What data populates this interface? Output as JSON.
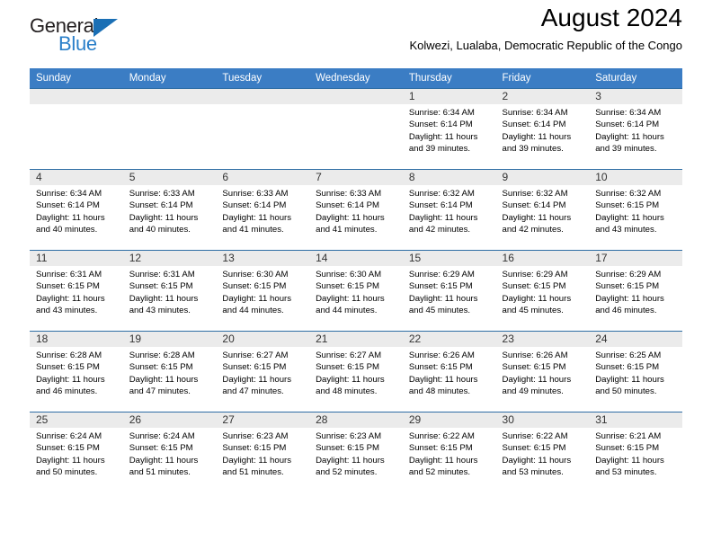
{
  "brand": {
    "name_top": "General",
    "name_bottom": "Blue",
    "triangle_icon": "triangle-icon",
    "accent_color": "#2a7fc9"
  },
  "header": {
    "title": "August 2024",
    "subtitle": "Kolwezi, Lualaba, Democratic Republic of the Congo"
  },
  "calendar": {
    "header_bg": "#3b7dc4",
    "daynum_bg": "#ebebeb",
    "weekdays": [
      "Sunday",
      "Monday",
      "Tuesday",
      "Wednesday",
      "Thursday",
      "Friday",
      "Saturday"
    ],
    "weeks": [
      [
        {
          "day": "",
          "sunrise": "",
          "sunset": "",
          "daylight_line1": "",
          "daylight_line2": ""
        },
        {
          "day": "",
          "sunrise": "",
          "sunset": "",
          "daylight_line1": "",
          "daylight_line2": ""
        },
        {
          "day": "",
          "sunrise": "",
          "sunset": "",
          "daylight_line1": "",
          "daylight_line2": ""
        },
        {
          "day": "",
          "sunrise": "",
          "sunset": "",
          "daylight_line1": "",
          "daylight_line2": ""
        },
        {
          "day": "1",
          "sunrise": "Sunrise: 6:34 AM",
          "sunset": "Sunset: 6:14 PM",
          "daylight_line1": "Daylight: 11 hours",
          "daylight_line2": "and 39 minutes."
        },
        {
          "day": "2",
          "sunrise": "Sunrise: 6:34 AM",
          "sunset": "Sunset: 6:14 PM",
          "daylight_line1": "Daylight: 11 hours",
          "daylight_line2": "and 39 minutes."
        },
        {
          "day": "3",
          "sunrise": "Sunrise: 6:34 AM",
          "sunset": "Sunset: 6:14 PM",
          "daylight_line1": "Daylight: 11 hours",
          "daylight_line2": "and 39 minutes."
        }
      ],
      [
        {
          "day": "4",
          "sunrise": "Sunrise: 6:34 AM",
          "sunset": "Sunset: 6:14 PM",
          "daylight_line1": "Daylight: 11 hours",
          "daylight_line2": "and 40 minutes."
        },
        {
          "day": "5",
          "sunrise": "Sunrise: 6:33 AM",
          "sunset": "Sunset: 6:14 PM",
          "daylight_line1": "Daylight: 11 hours",
          "daylight_line2": "and 40 minutes."
        },
        {
          "day": "6",
          "sunrise": "Sunrise: 6:33 AM",
          "sunset": "Sunset: 6:14 PM",
          "daylight_line1": "Daylight: 11 hours",
          "daylight_line2": "and 41 minutes."
        },
        {
          "day": "7",
          "sunrise": "Sunrise: 6:33 AM",
          "sunset": "Sunset: 6:14 PM",
          "daylight_line1": "Daylight: 11 hours",
          "daylight_line2": "and 41 minutes."
        },
        {
          "day": "8",
          "sunrise": "Sunrise: 6:32 AM",
          "sunset": "Sunset: 6:14 PM",
          "daylight_line1": "Daylight: 11 hours",
          "daylight_line2": "and 42 minutes."
        },
        {
          "day": "9",
          "sunrise": "Sunrise: 6:32 AM",
          "sunset": "Sunset: 6:14 PM",
          "daylight_line1": "Daylight: 11 hours",
          "daylight_line2": "and 42 minutes."
        },
        {
          "day": "10",
          "sunrise": "Sunrise: 6:32 AM",
          "sunset": "Sunset: 6:15 PM",
          "daylight_line1": "Daylight: 11 hours",
          "daylight_line2": "and 43 minutes."
        }
      ],
      [
        {
          "day": "11",
          "sunrise": "Sunrise: 6:31 AM",
          "sunset": "Sunset: 6:15 PM",
          "daylight_line1": "Daylight: 11 hours",
          "daylight_line2": "and 43 minutes."
        },
        {
          "day": "12",
          "sunrise": "Sunrise: 6:31 AM",
          "sunset": "Sunset: 6:15 PM",
          "daylight_line1": "Daylight: 11 hours",
          "daylight_line2": "and 43 minutes."
        },
        {
          "day": "13",
          "sunrise": "Sunrise: 6:30 AM",
          "sunset": "Sunset: 6:15 PM",
          "daylight_line1": "Daylight: 11 hours",
          "daylight_line2": "and 44 minutes."
        },
        {
          "day": "14",
          "sunrise": "Sunrise: 6:30 AM",
          "sunset": "Sunset: 6:15 PM",
          "daylight_line1": "Daylight: 11 hours",
          "daylight_line2": "and 44 minutes."
        },
        {
          "day": "15",
          "sunrise": "Sunrise: 6:29 AM",
          "sunset": "Sunset: 6:15 PM",
          "daylight_line1": "Daylight: 11 hours",
          "daylight_line2": "and 45 minutes."
        },
        {
          "day": "16",
          "sunrise": "Sunrise: 6:29 AM",
          "sunset": "Sunset: 6:15 PM",
          "daylight_line1": "Daylight: 11 hours",
          "daylight_line2": "and 45 minutes."
        },
        {
          "day": "17",
          "sunrise": "Sunrise: 6:29 AM",
          "sunset": "Sunset: 6:15 PM",
          "daylight_line1": "Daylight: 11 hours",
          "daylight_line2": "and 46 minutes."
        }
      ],
      [
        {
          "day": "18",
          "sunrise": "Sunrise: 6:28 AM",
          "sunset": "Sunset: 6:15 PM",
          "daylight_line1": "Daylight: 11 hours",
          "daylight_line2": "and 46 minutes."
        },
        {
          "day": "19",
          "sunrise": "Sunrise: 6:28 AM",
          "sunset": "Sunset: 6:15 PM",
          "daylight_line1": "Daylight: 11 hours",
          "daylight_line2": "and 47 minutes."
        },
        {
          "day": "20",
          "sunrise": "Sunrise: 6:27 AM",
          "sunset": "Sunset: 6:15 PM",
          "daylight_line1": "Daylight: 11 hours",
          "daylight_line2": "and 47 minutes."
        },
        {
          "day": "21",
          "sunrise": "Sunrise: 6:27 AM",
          "sunset": "Sunset: 6:15 PM",
          "daylight_line1": "Daylight: 11 hours",
          "daylight_line2": "and 48 minutes."
        },
        {
          "day": "22",
          "sunrise": "Sunrise: 6:26 AM",
          "sunset": "Sunset: 6:15 PM",
          "daylight_line1": "Daylight: 11 hours",
          "daylight_line2": "and 48 minutes."
        },
        {
          "day": "23",
          "sunrise": "Sunrise: 6:26 AM",
          "sunset": "Sunset: 6:15 PM",
          "daylight_line1": "Daylight: 11 hours",
          "daylight_line2": "and 49 minutes."
        },
        {
          "day": "24",
          "sunrise": "Sunrise: 6:25 AM",
          "sunset": "Sunset: 6:15 PM",
          "daylight_line1": "Daylight: 11 hours",
          "daylight_line2": "and 50 minutes."
        }
      ],
      [
        {
          "day": "25",
          "sunrise": "Sunrise: 6:24 AM",
          "sunset": "Sunset: 6:15 PM",
          "daylight_line1": "Daylight: 11 hours",
          "daylight_line2": "and 50 minutes."
        },
        {
          "day": "26",
          "sunrise": "Sunrise: 6:24 AM",
          "sunset": "Sunset: 6:15 PM",
          "daylight_line1": "Daylight: 11 hours",
          "daylight_line2": "and 51 minutes."
        },
        {
          "day": "27",
          "sunrise": "Sunrise: 6:23 AM",
          "sunset": "Sunset: 6:15 PM",
          "daylight_line1": "Daylight: 11 hours",
          "daylight_line2": "and 51 minutes."
        },
        {
          "day": "28",
          "sunrise": "Sunrise: 6:23 AM",
          "sunset": "Sunset: 6:15 PM",
          "daylight_line1": "Daylight: 11 hours",
          "daylight_line2": "and 52 minutes."
        },
        {
          "day": "29",
          "sunrise": "Sunrise: 6:22 AM",
          "sunset": "Sunset: 6:15 PM",
          "daylight_line1": "Daylight: 11 hours",
          "daylight_line2": "and 52 minutes."
        },
        {
          "day": "30",
          "sunrise": "Sunrise: 6:22 AM",
          "sunset": "Sunset: 6:15 PM",
          "daylight_line1": "Daylight: 11 hours",
          "daylight_line2": "and 53 minutes."
        },
        {
          "day": "31",
          "sunrise": "Sunrise: 6:21 AM",
          "sunset": "Sunset: 6:15 PM",
          "daylight_line1": "Daylight: 11 hours",
          "daylight_line2": "and 53 minutes."
        }
      ]
    ]
  }
}
